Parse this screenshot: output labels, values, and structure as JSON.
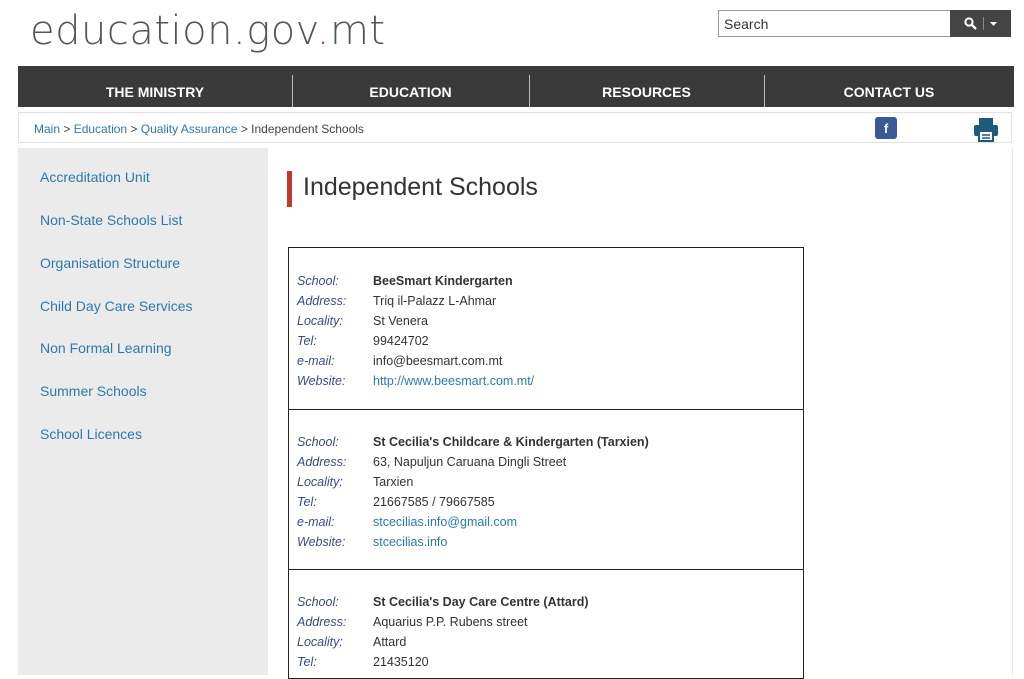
{
  "site": {
    "logo_main": "education.gov",
    "logo_dot": ".",
    "logo_tail": "mt"
  },
  "search": {
    "placeholder": "Search"
  },
  "nav": [
    "THE MINISTRY",
    "EDUCATION",
    "RESOURCES",
    "CONTACT US"
  ],
  "breadcrumb": {
    "items": [
      "Main",
      "Education",
      "Quality Assurance"
    ],
    "sep": " > ",
    "current": "Independent Schools"
  },
  "social": {
    "facebook": "f"
  },
  "sidebar": [
    "Accreditation Unit",
    "Non-State Schools List",
    "Organisation Structure",
    "Child Day Care Services",
    "Non Formal Learning",
    "Summer Schools",
    "School Licences"
  ],
  "page_title": "Independent Schools",
  "labels": {
    "school": "School:",
    "address": "Address:",
    "locality": "Locality:",
    "tel": "Tel:",
    "email": "e-mail:",
    "website": "Website:"
  },
  "schools": [
    {
      "school": "BeeSmart Kindergarten",
      "address": "Triq il-Palazz L-Ahmar",
      "locality": "St Venera",
      "tel": "99424702",
      "email": "info@beesmart.com.mt",
      "website": "http://www.beesmart.com.mt/"
    },
    {
      "school": "St Cecilia's Childcare & Kindergarten (Tarxien)",
      "address": "63, Napuljun Caruana Dingli Street",
      "locality": "Tarxien",
      "tel": "21667585 / 79667585",
      "email": "stcecilias.info@gmail.com",
      "website": "stcecilias.info"
    },
    {
      "school": "St Cecilia's Day Care Centre (Attard)",
      "address": "Aquarius P.P. Rubens street",
      "locality": "Attard",
      "tel": "21435120"
    }
  ],
  "colors": {
    "nav_bg": "#3a3a3a",
    "link": "#2a7ab0",
    "accent": "#c0392b",
    "sidebar_bg": "#ebebeb",
    "facebook": "#3b5998"
  }
}
